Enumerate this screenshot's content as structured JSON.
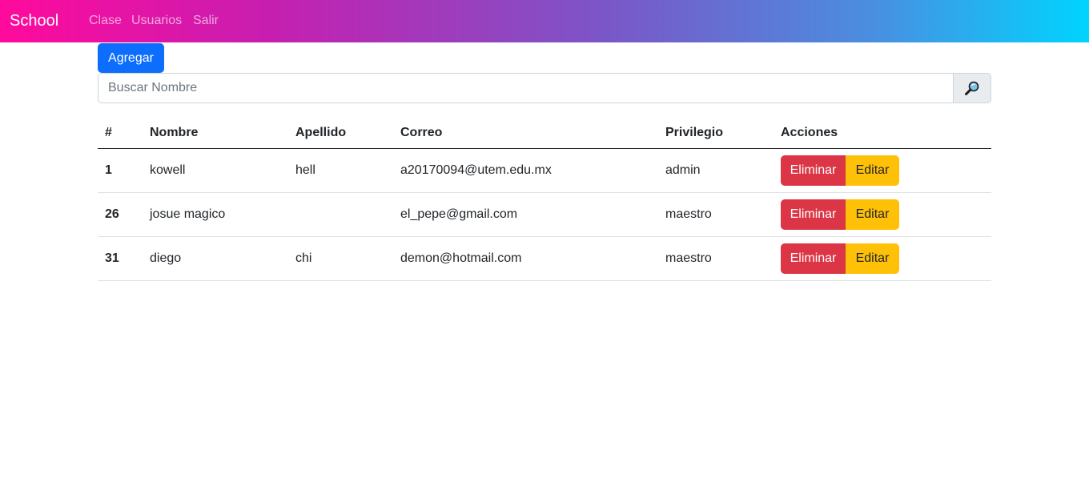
{
  "navbar": {
    "brand": "School",
    "links": [
      "Clase",
      "Usuarios",
      "Salir"
    ]
  },
  "toolbar": {
    "add_label": "Agregar"
  },
  "search": {
    "placeholder": "Buscar Nombre",
    "icon": "magnifier-icon"
  },
  "table": {
    "headers": [
      "#",
      "Nombre",
      "Apellido",
      "Correo",
      "Privilegio",
      "Acciones"
    ],
    "rows": [
      {
        "id": "1",
        "nombre": "kowell",
        "apellido": "hell",
        "correo": "a20170094@utem.edu.mx",
        "privilegio": "admin"
      },
      {
        "id": "26",
        "nombre": "josue magico",
        "apellido": "",
        "correo": "el_pepe@gmail.com",
        "privilegio": "maestro"
      },
      {
        "id": "31",
        "nombre": "diego",
        "apellido": "chi",
        "correo": "demon@hotmail.com",
        "privilegio": "maestro"
      }
    ],
    "delete_label": "Eliminar",
    "edit_label": "Editar"
  },
  "colors": {
    "primary": "#0d6efd",
    "danger": "#dc3545",
    "warning": "#ffc107",
    "gradient_start": "#ff0a9c",
    "gradient_end": "#00d4ff"
  }
}
